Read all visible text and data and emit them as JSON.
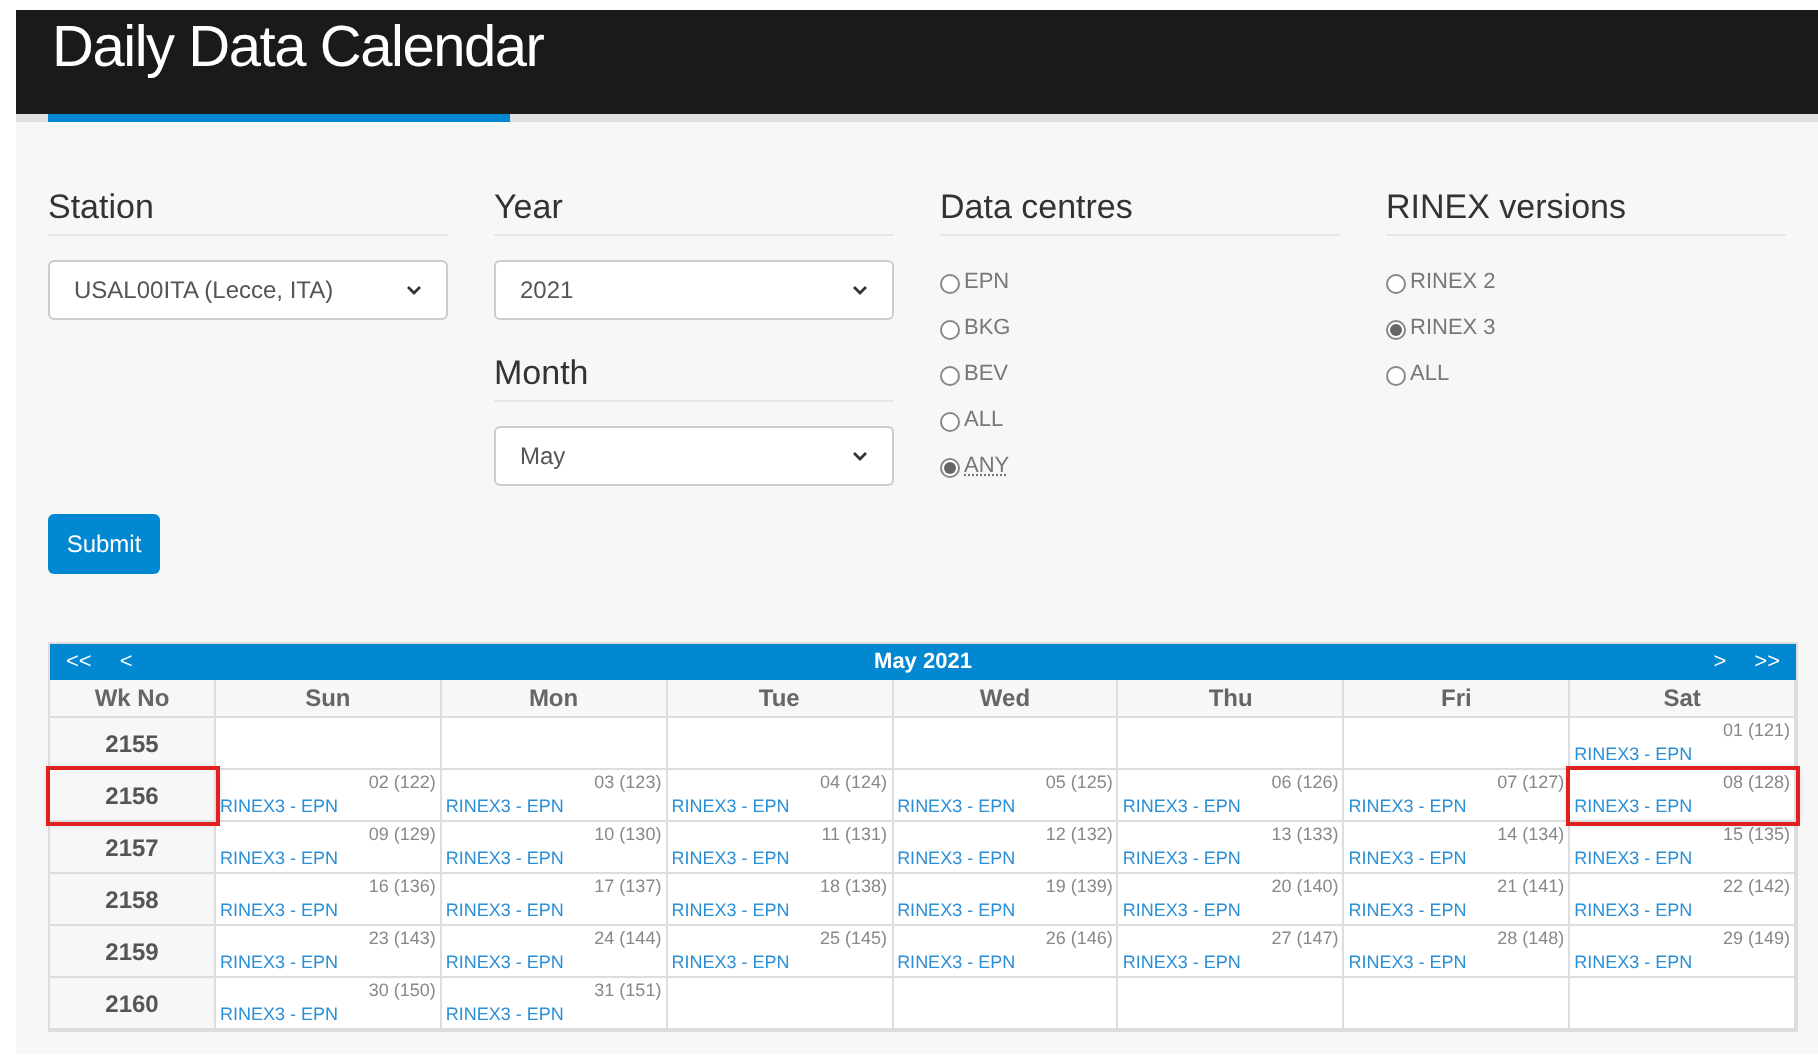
{
  "header": {
    "title": "Daily Data Calendar"
  },
  "station": {
    "label": "Station",
    "value": "USAL00ITA (Lecce, ITA)"
  },
  "year": {
    "label": "Year",
    "value": "2021"
  },
  "month": {
    "label": "Month",
    "value": "May"
  },
  "data_centres": {
    "label": "Data centres",
    "options": [
      {
        "label": "EPN",
        "selected": false
      },
      {
        "label": "BKG",
        "selected": false
      },
      {
        "label": "BEV",
        "selected": false
      },
      {
        "label": "ALL",
        "selected": false
      },
      {
        "label": "ANY",
        "selected": true
      }
    ]
  },
  "rinex_versions": {
    "label": "RINEX versions",
    "options": [
      {
        "label": "RINEX 2",
        "selected": false
      },
      {
        "label": "RINEX 3",
        "selected": true
      },
      {
        "label": "ALL",
        "selected": false
      }
    ]
  },
  "submit_button": "Submit",
  "calendar": {
    "prev_year": "<<",
    "prev_month": "<",
    "title": "May 2021",
    "next_month": ">",
    "next_year": ">>",
    "columns": [
      "Wk No",
      "Sun",
      "Mon",
      "Tue",
      "Wed",
      "Thu",
      "Fri",
      "Sat"
    ],
    "weeks": [
      {
        "number": "2155",
        "highlighted": false,
        "days": [
          {
            "kind": "empty"
          },
          {
            "kind": "empty"
          },
          {
            "kind": "empty"
          },
          {
            "kind": "empty"
          },
          {
            "kind": "empty"
          },
          {
            "kind": "empty"
          },
          {
            "kind": "day",
            "date": "01 (121)",
            "entry": "RINEX3 - EPN",
            "highlighted": false
          }
        ]
      },
      {
        "number": "2156",
        "highlighted": true,
        "days": [
          {
            "kind": "day",
            "date": "02 (122)",
            "entry": "RINEX3 - EPN",
            "highlighted": false
          },
          {
            "kind": "day",
            "date": "03 (123)",
            "entry": "RINEX3 - EPN",
            "highlighted": false
          },
          {
            "kind": "day",
            "date": "04 (124)",
            "entry": "RINEX3 - EPN",
            "highlighted": false
          },
          {
            "kind": "day",
            "date": "05 (125)",
            "entry": "RINEX3 - EPN",
            "highlighted": false
          },
          {
            "kind": "day",
            "date": "06 (126)",
            "entry": "RINEX3 - EPN",
            "highlighted": false
          },
          {
            "kind": "day",
            "date": "07 (127)",
            "entry": "RINEX3 - EPN",
            "highlighted": false
          },
          {
            "kind": "day",
            "date": "08 (128)",
            "entry": "RINEX3 - EPN",
            "highlighted": true
          }
        ]
      },
      {
        "number": "2157",
        "highlighted": false,
        "days": [
          {
            "kind": "day",
            "date": "09 (129)",
            "entry": "RINEX3 - EPN",
            "highlighted": false
          },
          {
            "kind": "day",
            "date": "10 (130)",
            "entry": "RINEX3 - EPN",
            "highlighted": false
          },
          {
            "kind": "day",
            "date": "11 (131)",
            "entry": "RINEX3 - EPN",
            "highlighted": false
          },
          {
            "kind": "day",
            "date": "12 (132)",
            "entry": "RINEX3 - EPN",
            "highlighted": false
          },
          {
            "kind": "day",
            "date": "13 (133)",
            "entry": "RINEX3 - EPN",
            "highlighted": false
          },
          {
            "kind": "day",
            "date": "14 (134)",
            "entry": "RINEX3 - EPN",
            "highlighted": false
          },
          {
            "kind": "day",
            "date": "15 (135)",
            "entry": "RINEX3 - EPN",
            "highlighted": false
          }
        ]
      },
      {
        "number": "2158",
        "highlighted": false,
        "days": [
          {
            "kind": "day",
            "date": "16 (136)",
            "entry": "RINEX3 - EPN",
            "highlighted": false
          },
          {
            "kind": "day",
            "date": "17 (137)",
            "entry": "RINEX3 - EPN",
            "highlighted": false
          },
          {
            "kind": "day",
            "date": "18 (138)",
            "entry": "RINEX3 - EPN",
            "highlighted": false
          },
          {
            "kind": "day",
            "date": "19 (139)",
            "entry": "RINEX3 - EPN",
            "highlighted": false
          },
          {
            "kind": "day",
            "date": "20 (140)",
            "entry": "RINEX3 - EPN",
            "highlighted": false
          },
          {
            "kind": "day",
            "date": "21 (141)",
            "entry": "RINEX3 - EPN",
            "highlighted": false
          },
          {
            "kind": "day",
            "date": "22 (142)",
            "entry": "RINEX3 - EPN",
            "highlighted": false
          }
        ]
      },
      {
        "number": "2159",
        "highlighted": false,
        "days": [
          {
            "kind": "day",
            "date": "23 (143)",
            "entry": "RINEX3 - EPN",
            "highlighted": false
          },
          {
            "kind": "day",
            "date": "24 (144)",
            "entry": "RINEX3 - EPN",
            "highlighted": false
          },
          {
            "kind": "day",
            "date": "25 (145)",
            "entry": "RINEX3 - EPN",
            "highlighted": false
          },
          {
            "kind": "day",
            "date": "26 (146)",
            "entry": "RINEX3 - EPN",
            "highlighted": false
          },
          {
            "kind": "day",
            "date": "27 (147)",
            "entry": "RINEX3 - EPN",
            "highlighted": false
          },
          {
            "kind": "day",
            "date": "28 (148)",
            "entry": "RINEX3 - EPN",
            "highlighted": false
          },
          {
            "kind": "day",
            "date": "29 (149)",
            "entry": "RINEX3 - EPN",
            "highlighted": false
          }
        ]
      },
      {
        "number": "2160",
        "highlighted": false,
        "days": [
          {
            "kind": "day",
            "date": "30 (150)",
            "entry": "RINEX3 - EPN",
            "highlighted": false
          },
          {
            "kind": "day",
            "date": "31 (151)",
            "entry": "RINEX3 - EPN",
            "highlighted": false
          },
          {
            "kind": "empty"
          },
          {
            "kind": "empty"
          },
          {
            "kind": "empty"
          },
          {
            "kind": "empty"
          },
          {
            "kind": "empty"
          }
        ]
      }
    ]
  }
}
